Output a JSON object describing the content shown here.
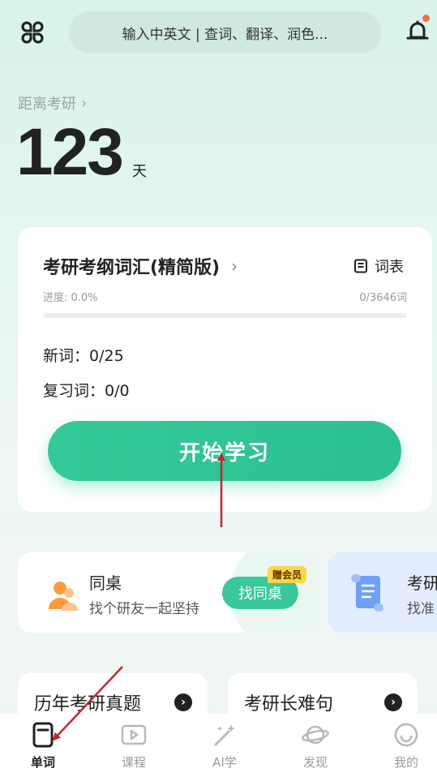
{
  "search": {
    "placeholder": "输入中英文 | 查词、翻译、润色..."
  },
  "countdown": {
    "label": "距离考研",
    "days": "123",
    "unit": "天"
  },
  "book": {
    "title": "考研考纲词汇(精简版)",
    "wordlist_label": "词表",
    "progress_label": "进度: 0.0%",
    "progress_fraction": 0.0,
    "progress_count": "0/3646词",
    "new_words": "新词：0/25",
    "review_words": "复习词：0/0",
    "start_label": "开始学习"
  },
  "deskmate": {
    "title": "同桌",
    "subtitle": "找个研友一起坚持",
    "button": "找同桌",
    "badge": "赠会员"
  },
  "side_card": {
    "title": "考研",
    "subtitle": "找准"
  },
  "bottom_cards": [
    {
      "title": "历年考研真题"
    },
    {
      "title": "考研长难句"
    }
  ],
  "nav": {
    "items": [
      {
        "label": "单词",
        "icon": "word-card-icon",
        "active": true
      },
      {
        "label": "课程",
        "icon": "play-icon",
        "active": false
      },
      {
        "label": "AI学",
        "icon": "magic-wand-icon",
        "active": false
      },
      {
        "label": "发现",
        "icon": "planet-icon",
        "active": false
      },
      {
        "label": "我的",
        "icon": "smiley-icon",
        "active": false
      }
    ]
  },
  "colors": {
    "accent": "#35c99a",
    "badge": "#ffd54a",
    "annotation_arrow": "#c0272d"
  }
}
